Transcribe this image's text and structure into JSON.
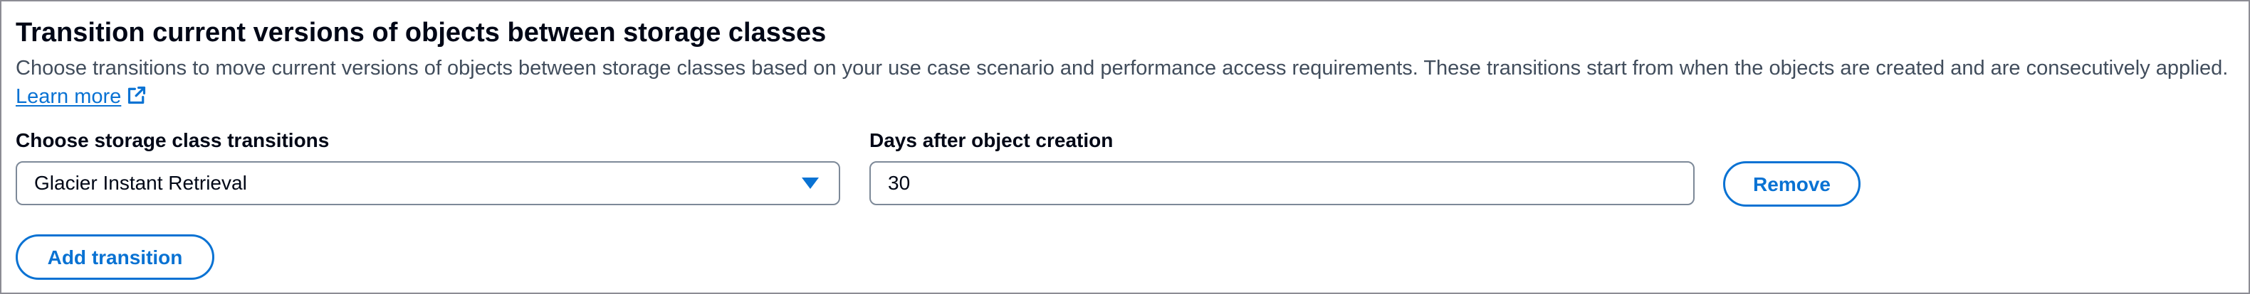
{
  "section": {
    "title": "Transition current versions of objects between storage classes",
    "description": "Choose transitions to move current versions of objects between storage classes based on your use case scenario and performance access requirements. These transitions start from when the objects are created and are consecutively applied.",
    "learn_more_label": "Learn more"
  },
  "icons": {
    "external_link": "external-link-icon",
    "dropdown_caret": "caret-down-icon"
  },
  "transition_row": {
    "storage_class_label": "Choose storage class transitions",
    "storage_class_value": "Glacier Instant Retrieval",
    "days_label": "Days after object creation",
    "days_value": "30",
    "remove_label": "Remove"
  },
  "actions": {
    "add_transition_label": "Add transition"
  },
  "colors": {
    "link": "#0972d3",
    "heading": "#000716",
    "body_text": "#414d5c",
    "input_border": "#7d8998",
    "panel_border": "#8c8c94"
  }
}
